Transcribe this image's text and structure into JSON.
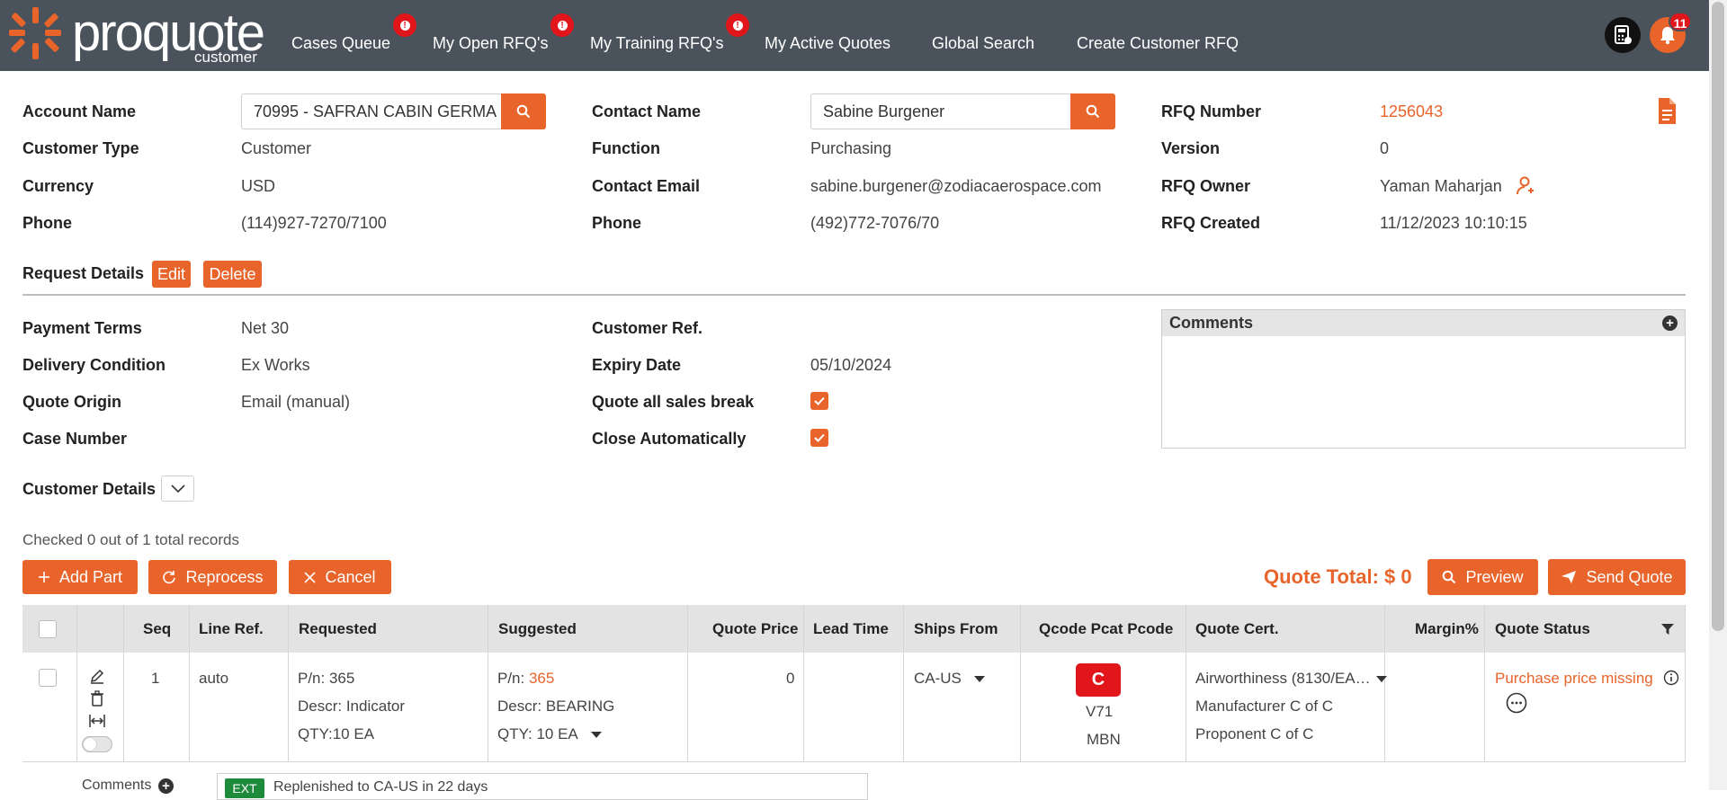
{
  "logo": {
    "text": "proquote",
    "sub": "customer"
  },
  "nav": {
    "items": [
      {
        "label": "Cases Queue",
        "badge": true
      },
      {
        "label": "My Open RFQ's",
        "badge": true
      },
      {
        "label": "My Training RFQ's",
        "badge": true
      },
      {
        "label": "My Active Quotes"
      },
      {
        "label": "Global Search"
      },
      {
        "label": "Create Customer RFQ"
      }
    ],
    "badge_glyph": "!",
    "notification_count": "11"
  },
  "header": {
    "account_name_label": "Account Name",
    "account_name_value": "70995 - SAFRAN CABIN GERMA",
    "customer_type_label": "Customer Type",
    "customer_type_value": "Customer",
    "currency_label": "Currency",
    "currency_value": "USD",
    "phone_label": "Phone",
    "phone_value": "(114)927-7270/7100",
    "contact_name_label": "Contact Name",
    "contact_name_value": "Sabine  Burgener",
    "function_label": "Function",
    "function_value": "Purchasing",
    "contact_email_label": "Contact Email",
    "contact_email_value": "sabine.burgener@zodiacaerospace.com",
    "contact_phone_label": "Phone",
    "contact_phone_value": "(492)772-7076/70",
    "rfq_number_label": "RFQ Number",
    "rfq_number_value": "1256043",
    "version_label": "Version",
    "version_value": "0",
    "rfq_owner_label": "RFQ Owner",
    "rfq_owner_value": "Yaman Maharjan",
    "rfq_created_label": "RFQ Created",
    "rfq_created_value": "11/12/2023 10:10:15"
  },
  "request": {
    "title": "Request Details",
    "edit_label": "Edit",
    "delete_label": "Delete",
    "payment_terms_label": "Payment Terms",
    "payment_terms_value": "Net 30",
    "delivery_condition_label": "Delivery Condition",
    "delivery_condition_value": "Ex Works",
    "quote_origin_label": "Quote Origin",
    "quote_origin_value": "Email (manual)",
    "case_number_label": "Case Number",
    "customer_ref_label": "Customer Ref.",
    "expiry_date_label": "Expiry Date",
    "expiry_date_value": "05/10/2024",
    "quote_all_label": "Quote all sales break",
    "quote_all_checked": true,
    "close_auto_label": "Close Automatically",
    "close_auto_checked": true,
    "comments_title": "Comments"
  },
  "customer_details_label": "Customer Details",
  "records": {
    "summary": "Checked 0 out of 1 total records",
    "add_part": "Add Part",
    "reprocess": "Reprocess",
    "cancel": "Cancel",
    "quote_total": "Quote Total: $ 0",
    "preview": "Preview",
    "send_quote": "Send Quote"
  },
  "table": {
    "headers": [
      "Seq",
      "Line Ref.",
      "Requested",
      "Suggested",
      "Quote Price",
      "Lead Time",
      "Ships From",
      "Qcode Pcat Pcode",
      "Quote Cert.",
      "Margin%",
      "Quote Status"
    ],
    "row": {
      "seq": "1",
      "line_ref": "auto",
      "req_pn": "P/n: 365",
      "req_descr": "Descr: Indicator",
      "req_qty": "QTY:10 EA",
      "sug_pn_label": "P/n: ",
      "sug_pn": "365",
      "sug_descr": "Descr: BEARING",
      "sug_qty": "QTY:  10  EA",
      "quote_price": "0",
      "ships_from": "CA-US",
      "qcode": "C",
      "pcat": "V71",
      "pcode": "MBN",
      "cert_1": "Airworthiness (8130/EA…",
      "cert_2": "Manufacturer C of C",
      "cert_3": "Proponent C of C",
      "status": "Purchase price missing"
    },
    "comments_label": "Comments",
    "comment_badge": "EXT",
    "comment_text": "Replenished to CA-US in 22 days"
  },
  "colors": {
    "accent": "#e8642a",
    "topbar": "#4a535c",
    "alert": "#e0161b"
  }
}
